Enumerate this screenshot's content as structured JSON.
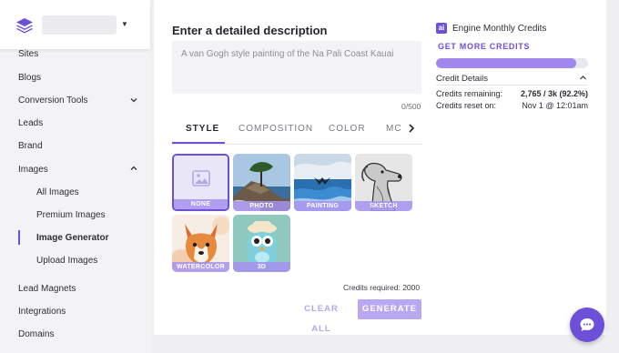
{
  "sidebar": {
    "items": [
      {
        "label": "Sites"
      },
      {
        "label": "Blogs"
      },
      {
        "label": "Conversion Tools"
      },
      {
        "label": "Leads"
      },
      {
        "label": "Brand"
      },
      {
        "label": "Images"
      }
    ],
    "image_subitems": [
      {
        "label": "All Images"
      },
      {
        "label": "Premium Images"
      },
      {
        "label": "Image Generator"
      },
      {
        "label": "Upload Images"
      }
    ],
    "bottom_items": [
      {
        "label": "Lead Magnets"
      },
      {
        "label": "Integrations"
      },
      {
        "label": "Domains"
      }
    ],
    "active_item": "Image Generator"
  },
  "generator": {
    "title": "Enter a detailed description",
    "placeholder": "A van Gogh style painting of the Na Pali Coast Kauai",
    "counter": "0/500",
    "tabs": [
      {
        "label": "STYLE"
      },
      {
        "label": "COMPOSITION"
      },
      {
        "label": "COLOR"
      },
      {
        "label": "MC"
      }
    ],
    "active_tab": "STYLE",
    "styles": [
      {
        "label": "NONE",
        "selected": true
      },
      {
        "label": "PHOTO"
      },
      {
        "label": "PAINTING"
      },
      {
        "label": "SKETCH"
      },
      {
        "label": "WATERCOLOR"
      },
      {
        "label": "3D"
      }
    ],
    "credits_required": "Credits required: 2000",
    "clear_label": "CLEAR ALL",
    "generate_label": "GENERATE"
  },
  "credits": {
    "badge": "ai",
    "title": "Engine Monthly Credits",
    "get_more": "GET MORE CREDITS",
    "used_fraction": 0.922,
    "details_title": "Credit Details",
    "remaining_label": "Credits remaining:",
    "remaining_value": "2,765 / 3k (92.2%)",
    "reset_label": "Credits reset on:",
    "reset_value": "Nov 1 @ 12:01am"
  },
  "colors": {
    "accent": "#6d4fd8",
    "bar": "#9f87ee"
  }
}
